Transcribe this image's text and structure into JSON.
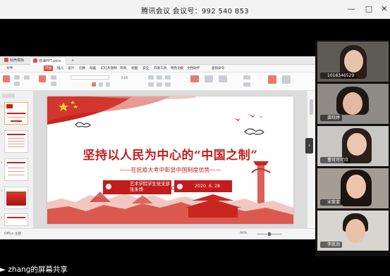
{
  "window": {
    "title": "腾讯会议 会议号：992 540 853"
  },
  "ppt": {
    "tabs": [
      "稻壳模板",
      "党课PPT.pptx"
    ],
    "menu": [
      "文件",
      "开始",
      "插入",
      "设计",
      "切换",
      "动画",
      "幻灯片放映",
      "审阅",
      "视图",
      "安全",
      "开发工具",
      "特色功能",
      "文档助手",
      "查找命令"
    ],
    "menu_active": "开始",
    "ribbon": {
      "zoom_field": "0.05"
    },
    "status": {
      "slide_info": "Office 主题",
      "zoom": "90%"
    }
  },
  "slide": {
    "title": "坚持以人民为中心的“中国之制”",
    "subtitle": "——在抗疫大考中彰显中国制度优势——",
    "box1_line1": "艺术学院学生党支部",
    "box1_line2": "张永博",
    "date": "2020. 6. 28"
  },
  "participants": [
    {
      "name": "1016346529"
    },
    {
      "name": "龚晓婷"
    },
    {
      "name": "董可可可欣"
    },
    {
      "name": "宋斐斐"
    },
    {
      "name": "李凯润"
    }
  ],
  "share_label": "zhang的屏幕共享"
}
